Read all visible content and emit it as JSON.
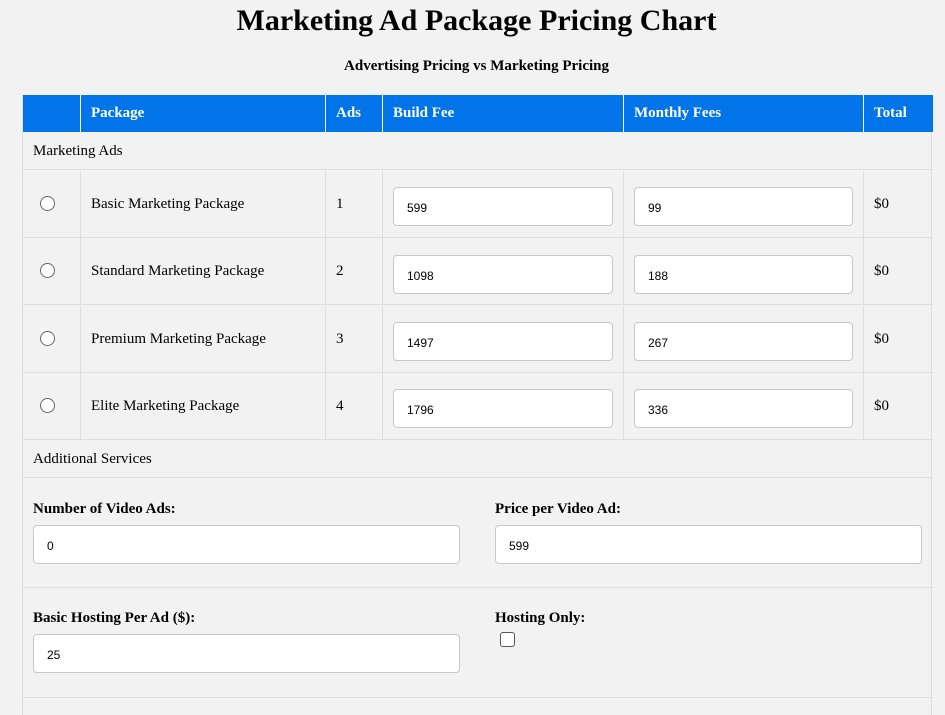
{
  "title": "Marketing Ad Package Pricing Chart",
  "subtitle": "Advertising Pricing vs Marketing Pricing",
  "columns": {
    "select": "",
    "package": "Package",
    "ads": "Ads",
    "build_fee": "Build Fee",
    "monthly_fees": "Monthly Fees",
    "total": "Total"
  },
  "section_marketing": "Marketing Ads",
  "packages": [
    {
      "name": "Basic Marketing Package",
      "ads": "1",
      "build_fee": "599",
      "monthly_fee": "99",
      "total": "$0",
      "selected": false
    },
    {
      "name": "Standard Marketing Package",
      "ads": "2",
      "build_fee": "1098",
      "monthly_fee": "188",
      "total": "$0",
      "selected": false
    },
    {
      "name": "Premium Marketing Package",
      "ads": "3",
      "build_fee": "1497",
      "monthly_fee": "267",
      "total": "$0",
      "selected": false
    },
    {
      "name": "Elite Marketing Package",
      "ads": "4",
      "build_fee": "1796",
      "monthly_fee": "336",
      "total": "$0",
      "selected": false
    }
  ],
  "section_additional": "Additional Services",
  "additional": {
    "video_ads_label": "Number of Video Ads:",
    "video_ads_value": "0",
    "price_per_video_label": "Price per Video Ad:",
    "price_per_video_value": "599",
    "hosting_label": "Basic Hosting Per Ad ($):",
    "hosting_value": "25",
    "hosting_only_label": "Hosting Only:",
    "hosting_only_checked": false
  }
}
